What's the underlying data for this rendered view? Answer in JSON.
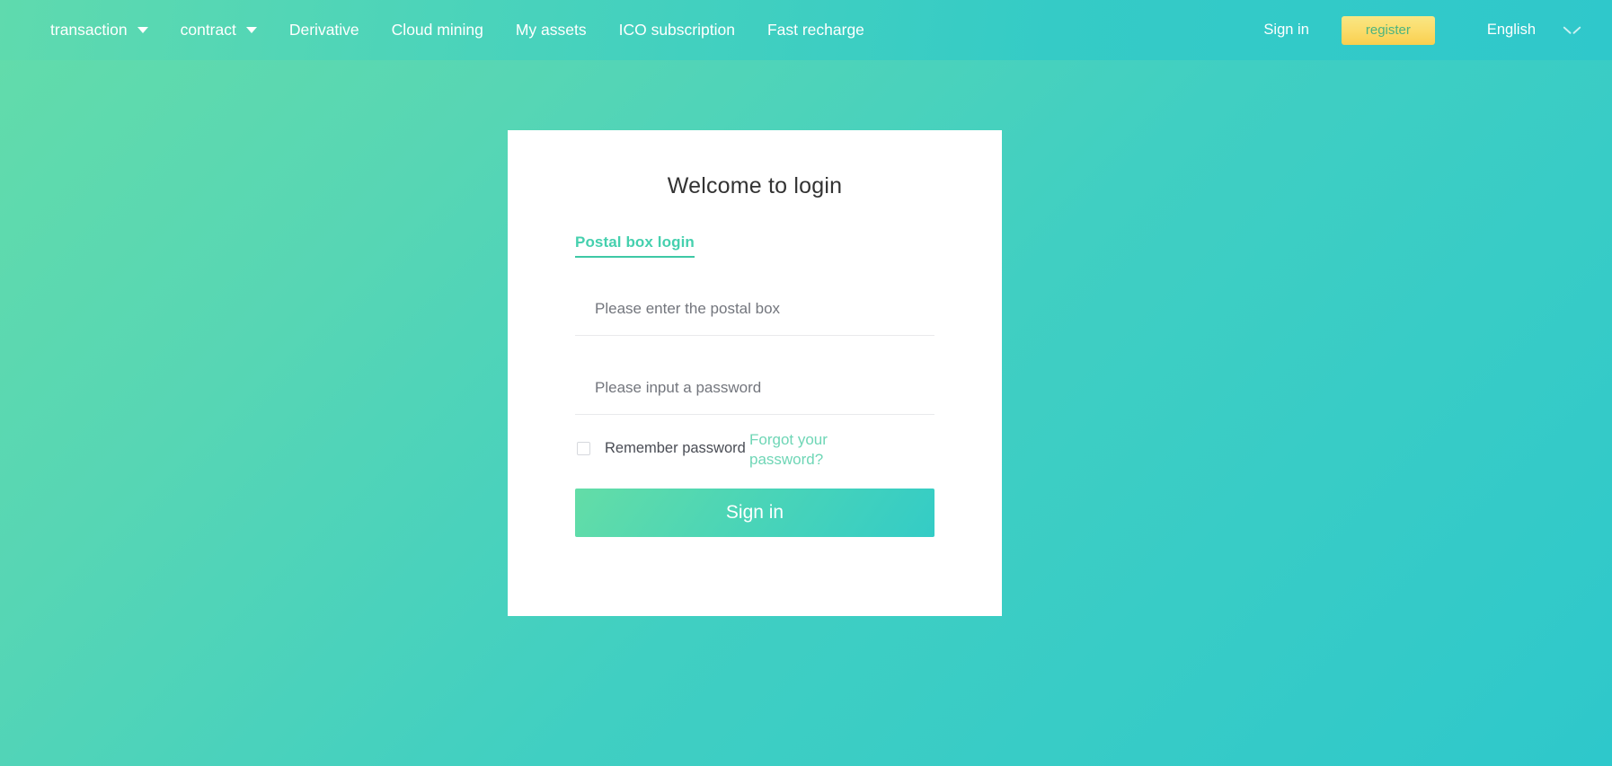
{
  "navbar": {
    "menu_items": [
      {
        "label": "transaction",
        "has_dropdown": true,
        "icon": "caret-down-icon"
      },
      {
        "label": "contract",
        "has_dropdown": true,
        "icon": "caret-down-icon"
      },
      {
        "label": "Derivative",
        "has_dropdown": false
      },
      {
        "label": "Cloud mining",
        "has_dropdown": false
      },
      {
        "label": "My assets",
        "has_dropdown": false
      },
      {
        "label": "ICO subscription",
        "has_dropdown": false
      },
      {
        "label": "Fast recharge",
        "has_dropdown": false
      }
    ],
    "sign_in_label": "Sign in",
    "register_label": "register",
    "language_label": "English",
    "language_icon": "chevron-down-icon"
  },
  "login_card": {
    "title": "Welcome to login",
    "tab_label": "Postal box login",
    "email": {
      "placeholder": "Please enter the postal box",
      "value": ""
    },
    "password": {
      "placeholder": "Please input a password",
      "value": ""
    },
    "remember_label": "Remember password",
    "remember_checked": false,
    "forgot_label": "Forgot your password?",
    "submit_label": "Sign in"
  },
  "colors": {
    "brand_green": "#5fdaae",
    "brand_teal": "#2fc8cb",
    "accent_yellow": "#f9cf4e",
    "register_text": "#4cb37f",
    "tab_green": "#45d0ae",
    "forgot_green": "#6fd6b6",
    "placeholder_gray": "#73767d",
    "card_bg": "#ffffff"
  }
}
